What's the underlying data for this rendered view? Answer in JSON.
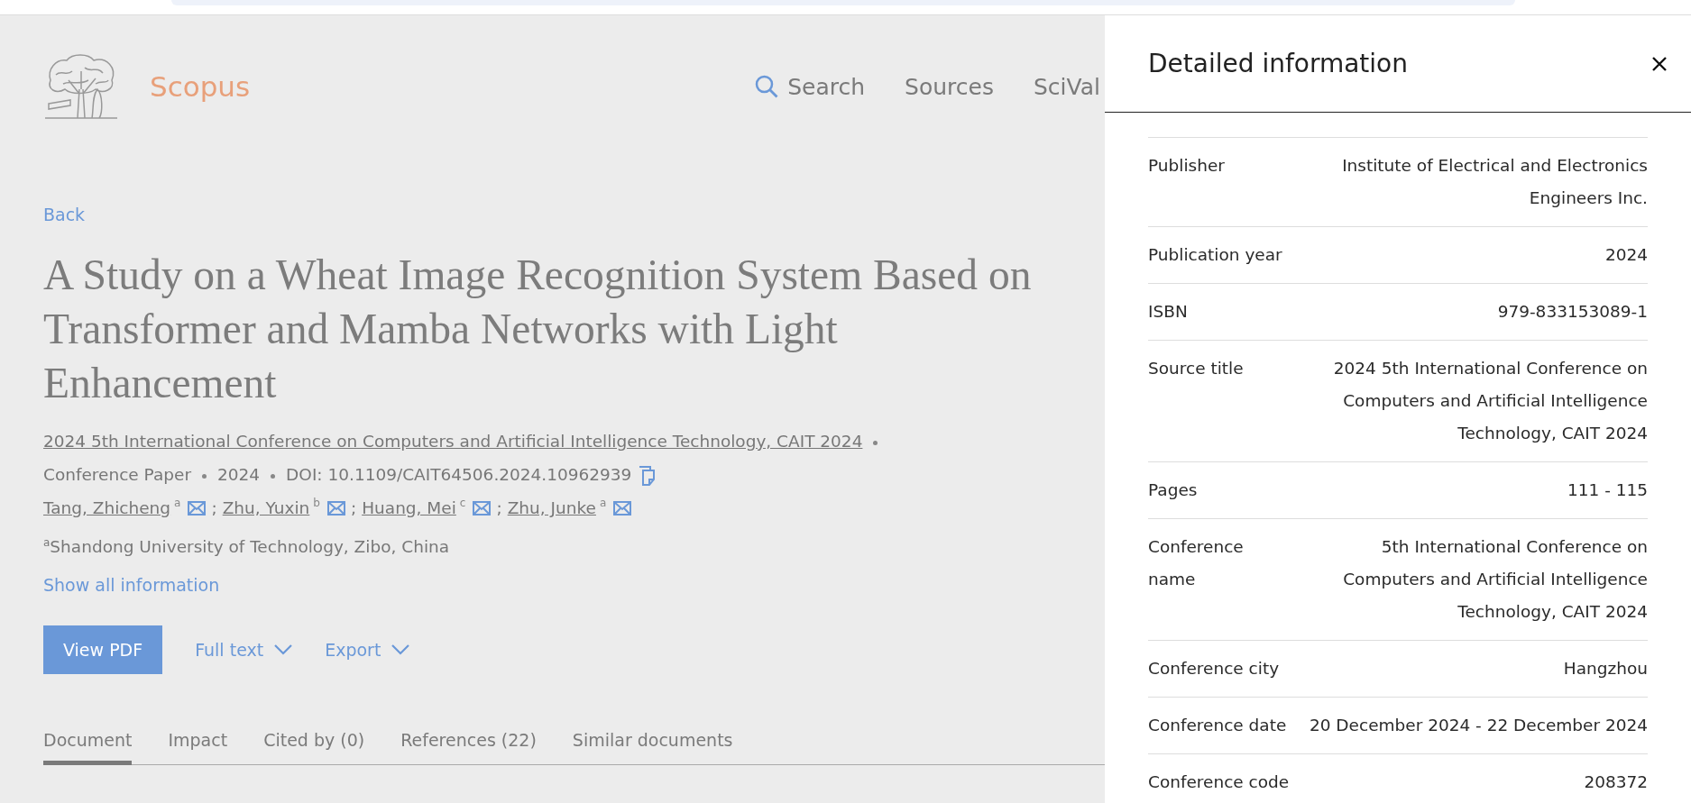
{
  "header": {
    "brand": "Scopus",
    "nav": [
      {
        "label": "Search",
        "kind": "search"
      },
      {
        "label": "Sources",
        "kind": "plain"
      },
      {
        "label": "SciVal",
        "kind": "plain"
      }
    ]
  },
  "back_link": "Back",
  "document": {
    "title": "A Study on a Wheat Image Recognition System Based on Transformer and Mamba Networks with Light Enhancement",
    "source_title": "2024 5th International Conference on Computers and Artificial Intelligence Technology, CAIT 2024",
    "meta": [
      "Conference Paper",
      "2024",
      "DOI: 10.1109/CAIT64506.2024.10962939"
    ],
    "authors": [
      {
        "name": "Tang, Zhicheng",
        "mark": "a",
        "separator": ";"
      },
      {
        "name": "Zhu, Yuxin",
        "mark": "b",
        "separator": ";"
      },
      {
        "name": "Huang, Mei",
        "mark": "c",
        "separator": ";"
      },
      {
        "name": "Zhu, Junke",
        "mark": "a"
      }
    ],
    "affiliation": "$^{a}$Shandong University of Technology, Zibo, China",
    "show_all": "Show all information"
  },
  "actions": [
    {
      "label": "View PDF",
      "kind": "primary"
    },
    {
      "label": "Full text",
      "kind": "dropdown"
    },
    {
      "label": "Export",
      "kind": "dropdown"
    }
  ],
  "tabs": [
    {
      "label": "Document",
      "selected": true
    },
    {
      "label": "Impact",
      "selected": false
    },
    {
      "label": "Cited by (0)",
      "selected": false
    },
    {
      "label": "References (22)",
      "selected": false
    },
    {
      "label": "Similar documents",
      "selected": false
    }
  ],
  "panel": {
    "title": "Detailed information",
    "rows": [
      {
        "label": "Publisher",
        "value": "Institute of Electrical and Electronics Engineers Inc."
      },
      {
        "label": "Publication year",
        "value": "2024"
      },
      {
        "label": "ISBN",
        "value": "979-833153089-1"
      },
      {
        "label": "Source title",
        "value": "2024 5th International Conference on Computers and Artificial Intelligence Technology, CAIT 2024"
      },
      {
        "label": "Pages",
        "value": "111 - 115"
      },
      {
        "label": "Conference name",
        "value": "5th International Conference on Computers and Artificial Intelligence Technology, CAIT 2024"
      },
      {
        "label": "Conference city",
        "value": "Hangzhou"
      },
      {
        "label": "Conference date",
        "value": "20 December 2024 - 22 December 2024"
      },
      {
        "label": "Conference code",
        "value": "208372"
      }
    ]
  }
}
